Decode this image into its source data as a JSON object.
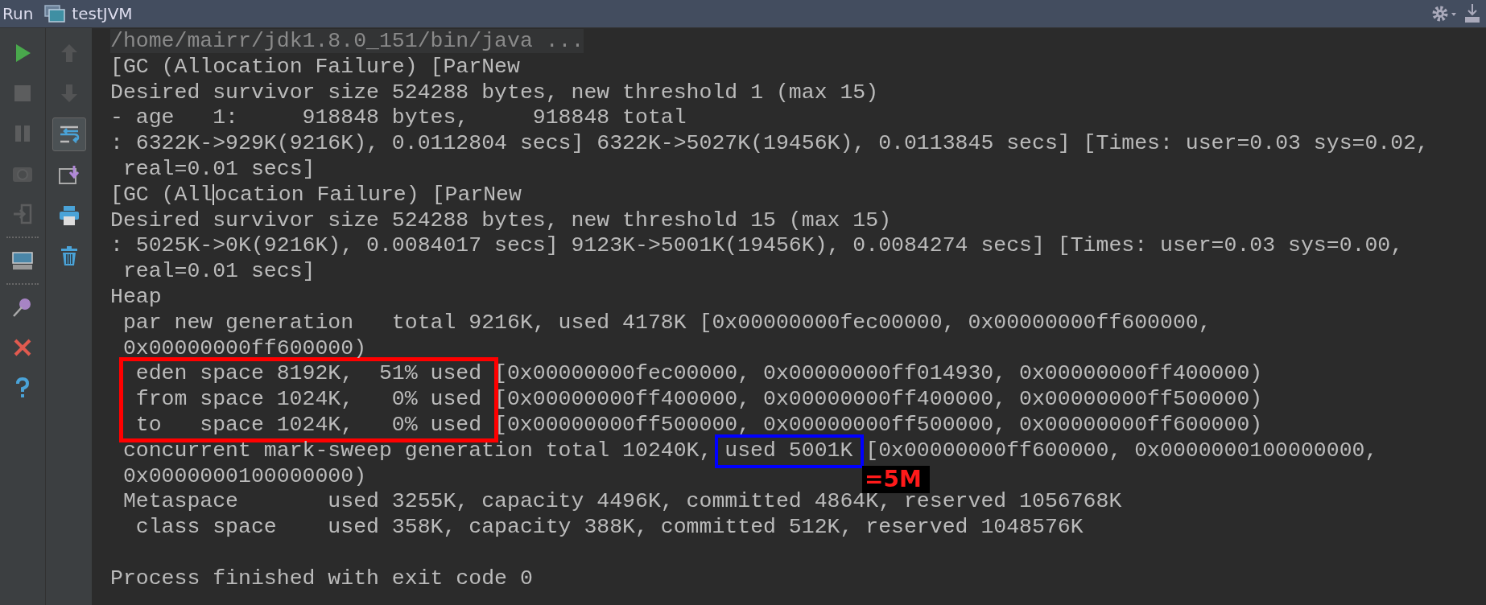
{
  "header": {
    "label": "Run",
    "config": "testJVM"
  },
  "toolbar_left": [
    {
      "kind": "run",
      "disabled": false
    },
    {
      "kind": "stop",
      "disabled": true
    },
    {
      "kind": "pause",
      "disabled": true
    },
    {
      "kind": "camera",
      "disabled": true
    },
    {
      "kind": "exit",
      "disabled": true
    },
    {
      "kind": "separator"
    },
    {
      "kind": "layout",
      "disabled": false
    },
    {
      "kind": "separator"
    },
    {
      "kind": "pin",
      "disabled": false
    },
    {
      "kind": "close",
      "disabled": false
    },
    {
      "kind": "help",
      "disabled": false
    }
  ],
  "toolbar_right": [
    {
      "kind": "up",
      "disabled": true,
      "selected": false
    },
    {
      "kind": "down",
      "disabled": true,
      "selected": false
    },
    {
      "kind": "wrap",
      "disabled": false,
      "selected": true
    },
    {
      "kind": "scroll_end",
      "disabled": false,
      "selected": false
    },
    {
      "kind": "print",
      "disabled": false,
      "selected": false
    },
    {
      "kind": "trash",
      "disabled": false,
      "selected": false
    }
  ],
  "console": {
    "lines": [
      {
        "kind": "command",
        "text": "/home/mairr/jdk1.8.0_151/bin/java ..."
      },
      {
        "kind": "plain",
        "text": "[GC (Allocation Failure) [ParNew"
      },
      {
        "kind": "plain",
        "text": "Desired survivor size 524288 bytes, new threshold 1 (max 15)"
      },
      {
        "kind": "plain",
        "text": "- age   1:     918848 bytes,     918848 total"
      },
      {
        "kind": "plain",
        "text": ": 6322K->929K(9216K), 0.0112804 secs] 6322K->5027K(19456K), 0.0113845 secs] [Times: user=0.03 sys=0.02,"
      },
      {
        "kind": "plain",
        "text": " real=0.01 secs]"
      },
      {
        "kind": "cursor",
        "before": "[GC (All",
        "after": "ocation Failure) [ParNew"
      },
      {
        "kind": "plain",
        "text": "Desired survivor size 524288 bytes, new threshold 15 (max 15)"
      },
      {
        "kind": "plain",
        "text": ": 5025K->0K(9216K), 0.0084017 secs] 9123K->5001K(19456K), 0.0084274 secs] [Times: user=0.03 sys=0.00,"
      },
      {
        "kind": "plain",
        "text": " real=0.01 secs]"
      },
      {
        "kind": "plain",
        "text": "Heap"
      },
      {
        "kind": "plain",
        "text": " par new generation   total 9216K, used 4178K [0x00000000fec00000, 0x00000000ff600000,"
      },
      {
        "kind": "plain",
        "text": " 0x00000000ff600000)"
      },
      {
        "kind": "boxed_group",
        "color": "#ff0000",
        "rows": [
          {
            "boxed": "eden space 8192K,  51% used",
            "rest": "[0x00000000fec00000, 0x00000000ff014930, 0x00000000ff400000)"
          },
          {
            "boxed": "from space 1024K,   0% used",
            "rest": "[0x00000000ff400000, 0x00000000ff400000, 0x00000000ff500000)"
          },
          {
            "boxed": "to   space 1024K,   0% used",
            "rest": "[0x00000000ff500000, 0x00000000ff500000, 0x00000000ff600000)"
          }
        ]
      },
      {
        "kind": "marked",
        "before": " concurrent mark-sweep generation total 10240K,",
        "marked": "used 5001K",
        "after": "[0x00000000ff600000, 0x0000000100000000,",
        "color": "#0000ff",
        "note": "=5M"
      },
      {
        "kind": "plain",
        "text": " 0x0000000100000000)"
      },
      {
        "kind": "plain",
        "text": " Metaspace       used 3255K, capacity 4496K, committed 4864K, reserved 1056768K"
      },
      {
        "kind": "plain",
        "text": "  class space    used 358K, capacity 388K, committed 512K, reserved 1048576K"
      },
      {
        "kind": "blank"
      },
      {
        "kind": "plain",
        "text": "Process finished with exit code 0"
      }
    ]
  }
}
